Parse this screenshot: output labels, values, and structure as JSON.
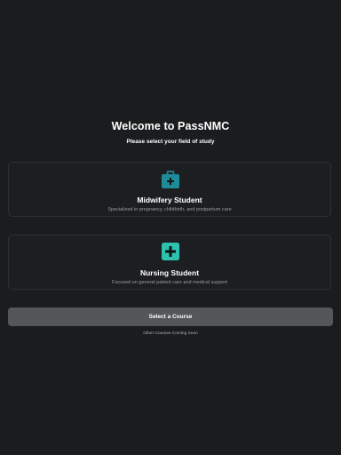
{
  "header": {
    "title": "Welcome to PassNMC",
    "subtitle": "Please select your field of study"
  },
  "courses": [
    {
      "title": "Midwifery Student",
      "description": "Specialized in pregnancy, childbirth, and postpartum care",
      "icon": "medical-bag-icon",
      "icon_color": "#1f8a98"
    },
    {
      "title": "Nursing Student",
      "description": "Focused on general patient care and medical support",
      "icon": "medical-cross-icon",
      "icon_color": "#2cc2ae"
    }
  ],
  "actions": {
    "select_label": "Select a Course",
    "footer_note": "Other Courses Coming Soon"
  },
  "colors": {
    "background": "#1b1c1e",
    "card_border": "#2e3033",
    "button_bg": "#555658"
  }
}
